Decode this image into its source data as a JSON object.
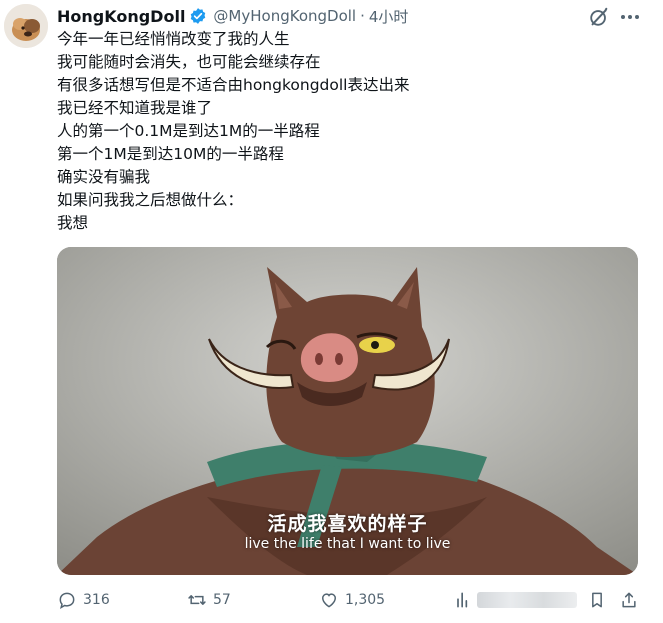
{
  "author": {
    "name": "HongKongDoll",
    "handle": "@MyHongKongDoll",
    "separator": "·",
    "time": "4小时"
  },
  "icons": {
    "verified": "verified-badge-icon",
    "grok": "grok-icon",
    "more": "more-icon",
    "reply": "reply-icon",
    "retweet": "retweet-icon",
    "like": "like-icon",
    "views": "views-icon",
    "bookmark": "bookmark-icon",
    "share": "share-icon"
  },
  "colors": {
    "text": "#0f1419",
    "secondary": "#536471",
    "verified": "#1d9bf0"
  },
  "tweet": {
    "lines": [
      "今年一年已经悄悄改变了我的人生",
      "我可能随时会消失，也可能会继续存在",
      "有很多话想写但是不适合由hongkongdoll表达出来",
      "我已经不知道我是谁了",
      "人的第一个0.1M是到达1M的一半路程",
      "第一个1M是到达10M的一半路程",
      "确实没有骗我",
      "如果问我我之后想做什么：",
      "我想"
    ]
  },
  "media": {
    "subtitle_cn": "活成我喜欢的样子",
    "subtitle_en": "live the life that I want to live"
  },
  "actions": {
    "replies": "316",
    "retweets": "57",
    "likes": "1,305"
  }
}
